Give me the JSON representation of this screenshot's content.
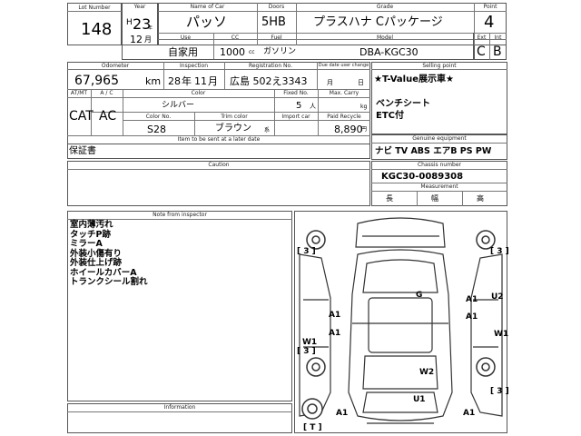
{
  "headers": {
    "lot_number": "Lot Number",
    "year": "Year",
    "car_name": "Name of Car",
    "doors": "Doors",
    "grade": "Grade",
    "point": "Point",
    "use": "Use",
    "cc": "CC",
    "fuel": "Fuel",
    "model": "Model",
    "ext": "Ext",
    "int": "Int",
    "odometer": "Odometer",
    "inspection": "Inspection",
    "registration_no": "Registration No.",
    "due_date": "Due date user change",
    "selling_point": "Selling point",
    "at_mt": "AT/MT",
    "ac": "A / C",
    "color": "Color",
    "fixed_no": "Fixed No.",
    "max_carry": "Max. Carry",
    "color_no": "Color No.",
    "trim_color": "Trim color",
    "import_car": "Import car",
    "paid_recycle": "Paid Recycle",
    "items_sent_later": "Item to be sent at a later date",
    "genuine_equipment": "Genuine equipment",
    "caution": "Caution",
    "chassis_number": "Chassis number",
    "measurement": "Measurement",
    "note_from_inspector": "Note from inspector",
    "information": "Information"
  },
  "lot": {
    "lot_number": "148",
    "era": "H",
    "year": "23",
    "year_suffix": "年",
    "month": "12",
    "month_suffix": "月",
    "car_name": "パッソ",
    "doors": "5HB",
    "grade": "プラスハナ Cパッケージ",
    "point": "4",
    "use": "自家用",
    "cc": "1000",
    "cc_unit": "cc",
    "fuel": "ガソリン",
    "model": "DBA-KGC30",
    "ext": "C",
    "int": "B",
    "odometer": "67,965",
    "odometer_unit": "km",
    "inspection_year": "28",
    "inspection_year_suffix": "年",
    "inspection_month": "11",
    "inspection_month_suffix": "月",
    "registration": "広島 502え3343",
    "due_month": "月",
    "due_day": "日",
    "at_mt": "CAT",
    "ac": "AC",
    "color": "シルバー",
    "fixed_no": "5",
    "fixed_unit": "人",
    "max_carry_unit": "kg",
    "color_no": "S28",
    "trim_color": "ブラウン",
    "trim_suffix": "系",
    "paid_recycle": "8,890",
    "recycle_unit": "円",
    "items_sent_later": "保証書",
    "selling_points": [
      "★T-Value展示車★",
      "",
      "ベンチシート",
      "ETC付"
    ],
    "genuine_equipment": "ナビ TV ABS エアB PS PW",
    "chassis_number": "KGC30-0089308",
    "measurement_length": "長",
    "measurement_width": "幅",
    "measurement_height": "高"
  },
  "inspector_notes": [
    "室内薄汚れ",
    "タッチP跡",
    "ミラーA",
    "外装小傷有り",
    "外装仕上げ跡",
    "ホイールカバーA",
    "トランクシール割れ"
  ],
  "damage_marks": {
    "front_left_tire": "[ 3 ]",
    "front_right_tire": "[ 3 ]",
    "rear_left_tire": "[ 3 ]",
    "rear_right_tire": "[ 3 ]",
    "spare": "[ T ]",
    "roof": "G",
    "left_front_door": "A1",
    "left_rear_door": "A1",
    "right_front_door": "A1",
    "right_rear_door": "A1",
    "right_rear_quarter": "U2",
    "left_front_wheel": "W1",
    "right_front_wheel": "W1",
    "rear_glass": "W2",
    "rear_bumper": "U1",
    "rear_left_lamp": "A1",
    "rear_right_lamp": "A1"
  }
}
